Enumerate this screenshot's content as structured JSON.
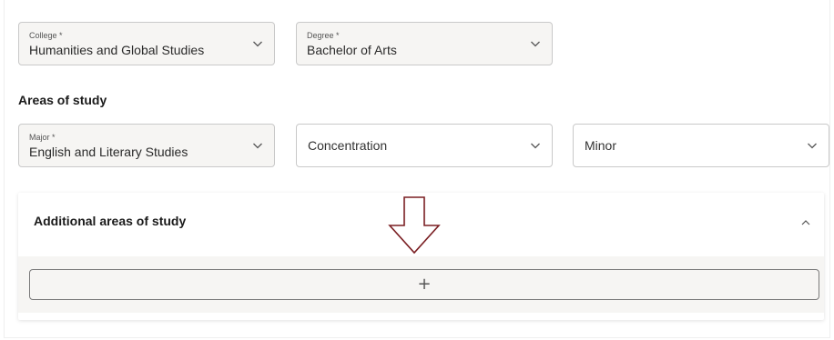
{
  "form": {
    "college": {
      "label": "College *",
      "value": "Humanities and Global Studies"
    },
    "degree": {
      "label": "Degree *",
      "value": "Bachelor of Arts"
    }
  },
  "areas_of_study": {
    "heading": "Areas of study",
    "major": {
      "label": "Major *",
      "value": "English and Literary Studies"
    },
    "concentration": {
      "placeholder": "Concentration"
    },
    "minor": {
      "placeholder": "Minor"
    }
  },
  "additional": {
    "title": "Additional areas of study",
    "add_label": "+"
  },
  "colors": {
    "field_bg": "#f6f5f3",
    "field_border": "#c9c9c9",
    "annotation_arrow": "#7a1e22"
  },
  "icons": {
    "dropdown": "chevron-down-icon",
    "collapse": "chevron-up-icon",
    "annotation": "arrow-down-outline-icon"
  }
}
